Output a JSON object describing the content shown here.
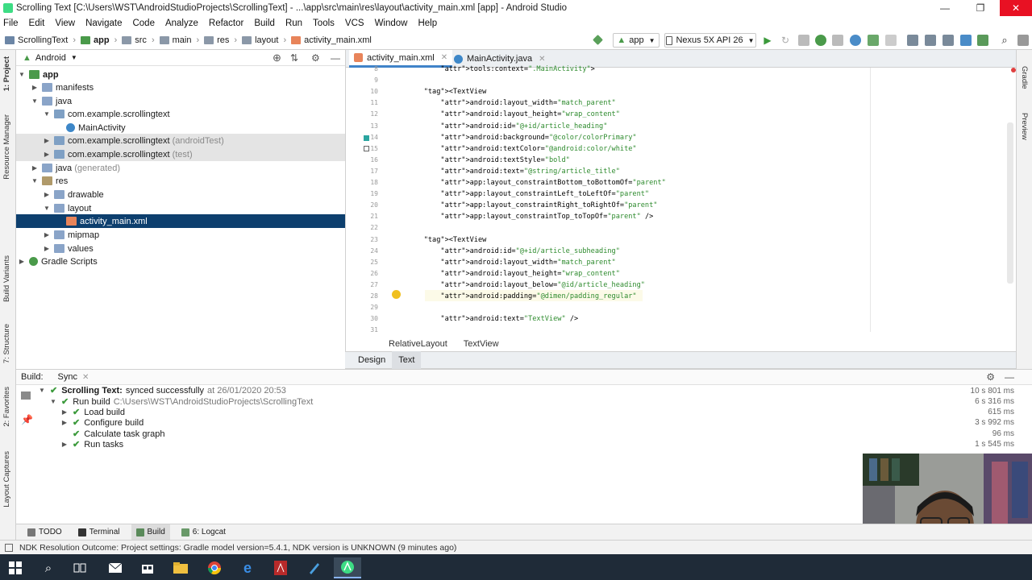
{
  "window": {
    "title": "Scrolling Text [C:\\Users\\WST\\AndroidStudioProjects\\ScrollingText] - ...\\app\\src\\main\\res\\layout\\activity_main.xml [app] - Android Studio",
    "minimize": "—",
    "maximize": "❐",
    "close": "✕"
  },
  "menu": [
    "File",
    "Edit",
    "View",
    "Navigate",
    "Code",
    "Analyze",
    "Refactor",
    "Build",
    "Run",
    "Tools",
    "VCS",
    "Window",
    "Help"
  ],
  "breadcrumb": [
    "ScrollingText",
    "app",
    "src",
    "main",
    "res",
    "layout",
    "activity_main.xml"
  ],
  "toolbar": {
    "run_config": "app",
    "device": "Nexus 5X API 26"
  },
  "project_panel": {
    "view_mode": "Android",
    "tree": [
      {
        "label": "app",
        "muted": ""
      },
      {
        "label": "manifests",
        "muted": ""
      },
      {
        "label": "java",
        "muted": ""
      },
      {
        "label": "com.example.scrollingtext",
        "muted": ""
      },
      {
        "label": "MainActivity",
        "muted": ""
      },
      {
        "label": "com.example.scrollingtext",
        "muted": "(androidTest)"
      },
      {
        "label": "com.example.scrollingtext",
        "muted": "(test)"
      },
      {
        "label": "java",
        "muted": "(generated)"
      },
      {
        "label": "res",
        "muted": ""
      },
      {
        "label": "drawable",
        "muted": ""
      },
      {
        "label": "layout",
        "muted": ""
      },
      {
        "label": "activity_main.xml",
        "muted": ""
      },
      {
        "label": "mipmap",
        "muted": ""
      },
      {
        "label": "values",
        "muted": ""
      },
      {
        "label": "Gradle Scripts",
        "muted": ""
      }
    ]
  },
  "left_strip": {
    "project": "1: Project",
    "resource_manager": "Resource Manager",
    "build_variants": "Build Variants",
    "structure": "7: Structure",
    "favorites": "2: Favorites",
    "layout_captures": "Layout Captures"
  },
  "right_strip": {
    "gradle": "Gradle",
    "preview": "Preview"
  },
  "editor": {
    "tabs": [
      "activity_main.xml",
      "MainActivity.java"
    ],
    "lines": [
      {
        "n": "8",
        "c": "        tools:context=\".MainActivity\">"
      },
      {
        "n": "9",
        "c": ""
      },
      {
        "n": "10",
        "c": "    <TextView"
      },
      {
        "n": "11",
        "c": "        android:layout_width=\"match_parent\""
      },
      {
        "n": "12",
        "c": "        android:layout_height=\"wrap_content\""
      },
      {
        "n": "13",
        "c": "        android:id=\"@+id/article_heading\""
      },
      {
        "n": "14",
        "c": "        android:background=\"@color/colorPrimary\""
      },
      {
        "n": "15",
        "c": "        android:textColor=\"@android:color/white\""
      },
      {
        "n": "16",
        "c": "        android:textStyle=\"bold\""
      },
      {
        "n": "17",
        "c": "        android:text=\"@string/article_title\""
      },
      {
        "n": "18",
        "c": "        app:layout_constraintBottom_toBottomOf=\"parent\""
      },
      {
        "n": "19",
        "c": "        app:layout_constraintLeft_toLeftOf=\"parent\""
      },
      {
        "n": "20",
        "c": "        app:layout_constraintRight_toRightOf=\"parent\""
      },
      {
        "n": "21",
        "c": "        app:layout_constraintTop_toTopOf=\"parent\" />"
      },
      {
        "n": "22",
        "c": ""
      },
      {
        "n": "23",
        "c": "    <TextView"
      },
      {
        "n": "24",
        "c": "        android:id=\"@+id/article_subheading\""
      },
      {
        "n": "25",
        "c": "        android:layout_width=\"match_parent\""
      },
      {
        "n": "26",
        "c": "        android:layout_height=\"wrap_content\""
      },
      {
        "n": "27",
        "c": "        android:layout_below=\"@id/article_heading\""
      },
      {
        "n": "28",
        "c": "        android:padding=\"@dimen/padding_regular\""
      },
      {
        "n": "29",
        "c": ""
      },
      {
        "n": "30",
        "c": "        android:text=\"TextView\" />"
      },
      {
        "n": "31",
        "c": ""
      }
    ],
    "crumbs": [
      "RelativeLayout",
      "TextView"
    ],
    "design_tab": "Design",
    "text_tab": "Text"
  },
  "build": {
    "tab_build": "Build:",
    "tab_sync": "Sync",
    "rows": [
      {
        "label": "Scrolling Text:",
        "detail": "synced successfully",
        "extra": "at 26/01/2020 20:53",
        "time": "10 s 801 ms"
      },
      {
        "label": "Run build",
        "detail": "",
        "extra": "C:\\Users\\WST\\AndroidStudioProjects\\ScrollingText",
        "time": "6 s 316 ms"
      },
      {
        "label": "Load build",
        "detail": "",
        "extra": "",
        "time": "615 ms"
      },
      {
        "label": "Configure build",
        "detail": "",
        "extra": "",
        "time": "3 s 992 ms"
      },
      {
        "label": "Calculate task graph",
        "detail": "",
        "extra": "",
        "time": "96 ms"
      },
      {
        "label": "Run tasks",
        "detail": "",
        "extra": "",
        "time": "1 s 545 ms"
      }
    ]
  },
  "bottom_tabs": [
    "TODO",
    "Terminal",
    "Build",
    "6: Logcat"
  ],
  "status": "NDK Resolution Outcome: Project settings: Gradle model version=5.4.1, NDK version is UNKNOWN (9 minutes ago)",
  "colors": {
    "selection": "#0d3f6e",
    "accent": "#4083c9",
    "success": "#3b9a3b",
    "close_red": "#e81123",
    "taskbar": "#1f2b38"
  }
}
